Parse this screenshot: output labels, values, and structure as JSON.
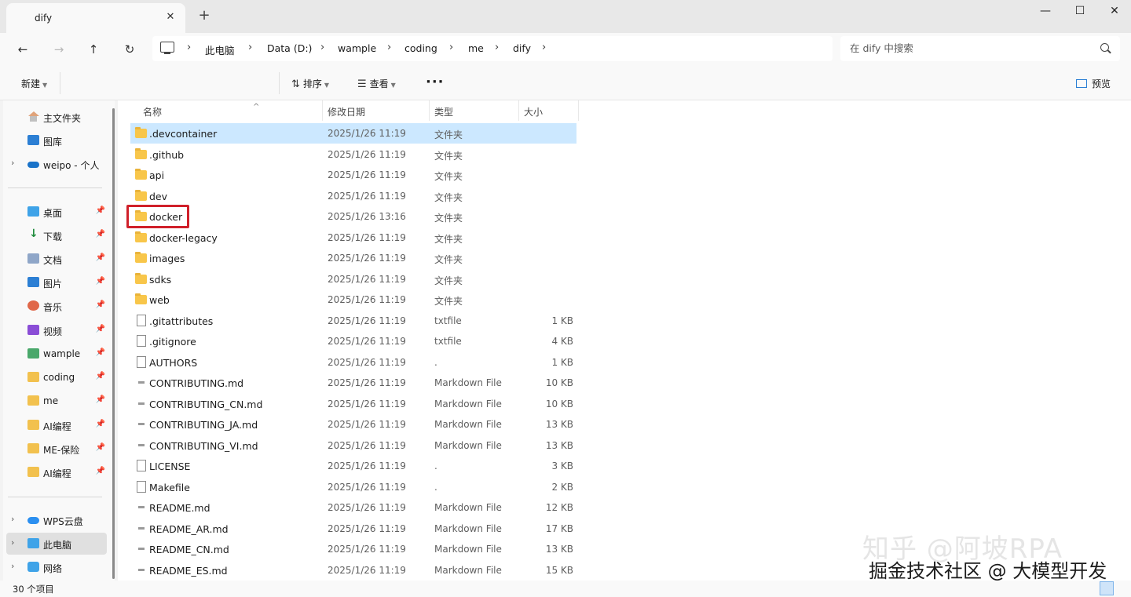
{
  "window": {
    "tab_title": "dify",
    "tab_close": "✕",
    "new_tab": "+",
    "minimize": "—",
    "maximize": "☐",
    "close": "✕"
  },
  "nav": {
    "back": "←",
    "forward": "→",
    "up": "↑",
    "refresh": "↻",
    "breadcrumbs": [
      "此电脑",
      "Data (D:)",
      "wample",
      "coding",
      "me",
      "dify"
    ],
    "chevron": "›",
    "search_placeholder": "在 dify 中搜索"
  },
  "toolbar": {
    "new_label": "新建",
    "sort_label": "排序",
    "view_label": "查看",
    "more_label": "···",
    "preview_label": "预览"
  },
  "sidebar": {
    "items": [
      {
        "label": "主文件夹",
        "icon": "home-icon"
      },
      {
        "label": "图库",
        "icon": "gallery-icon"
      },
      {
        "label": "weipo - 个人",
        "icon": "onedrive-icon"
      },
      {
        "label": "桌面",
        "icon": "desktop-icon"
      },
      {
        "label": "下载",
        "icon": "download-icon"
      },
      {
        "label": "文档",
        "icon": "documents-icon"
      },
      {
        "label": "图片",
        "icon": "pictures-icon"
      },
      {
        "label": "音乐",
        "icon": "music-icon"
      },
      {
        "label": "视频",
        "icon": "videos-icon"
      },
      {
        "label": "wample",
        "icon": "folder-icon"
      },
      {
        "label": "coding",
        "icon": "folder-icon"
      },
      {
        "label": "me",
        "icon": "folder-icon"
      },
      {
        "label": "AI编程",
        "icon": "folder-icon"
      },
      {
        "label": "ME-保险",
        "icon": "folder-icon"
      },
      {
        "label": "AI编程",
        "icon": "folder-icon"
      },
      {
        "label": "WPS云盘",
        "icon": "wps-cloud-icon"
      },
      {
        "label": "此电脑",
        "icon": "this-pc-icon"
      },
      {
        "label": "网络",
        "icon": "network-icon"
      }
    ],
    "pin": "📌",
    "expand": "›"
  },
  "columns": {
    "name": "名称",
    "date": "修改日期",
    "type": "类型",
    "size": "大小"
  },
  "files": [
    {
      "name": ".devcontainer",
      "date": "2025/1/26 11:19",
      "type": "文件夹",
      "size": "",
      "kind": "folder"
    },
    {
      "name": ".github",
      "date": "2025/1/26 11:19",
      "type": "文件夹",
      "size": "",
      "kind": "folder"
    },
    {
      "name": "api",
      "date": "2025/1/26 11:19",
      "type": "文件夹",
      "size": "",
      "kind": "folder"
    },
    {
      "name": "dev",
      "date": "2025/1/26 11:19",
      "type": "文件夹",
      "size": "",
      "kind": "folder"
    },
    {
      "name": "docker",
      "date": "2025/1/26 13:16",
      "type": "文件夹",
      "size": "",
      "kind": "folder"
    },
    {
      "name": "docker-legacy",
      "date": "2025/1/26 11:19",
      "type": "文件夹",
      "size": "",
      "kind": "folder"
    },
    {
      "name": "images",
      "date": "2025/1/26 11:19",
      "type": "文件夹",
      "size": "",
      "kind": "folder"
    },
    {
      "name": "sdks",
      "date": "2025/1/26 11:19",
      "type": "文件夹",
      "size": "",
      "kind": "folder"
    },
    {
      "name": "web",
      "date": "2025/1/26 11:19",
      "type": "文件夹",
      "size": "",
      "kind": "folder"
    },
    {
      "name": ".gitattributes",
      "date": "2025/1/26 11:19",
      "type": "txtfile",
      "size": "1 KB",
      "kind": "file"
    },
    {
      "name": ".gitignore",
      "date": "2025/1/26 11:19",
      "type": "txtfile",
      "size": "4 KB",
      "kind": "file"
    },
    {
      "name": "AUTHORS",
      "date": "2025/1/26 11:19",
      "type": ".",
      "size": "1 KB",
      "kind": "file"
    },
    {
      "name": "CONTRIBUTING.md",
      "date": "2025/1/26 11:19",
      "type": "Markdown File",
      "size": "10 KB",
      "kind": "md"
    },
    {
      "name": "CONTRIBUTING_CN.md",
      "date": "2025/1/26 11:19",
      "type": "Markdown File",
      "size": "10 KB",
      "kind": "md"
    },
    {
      "name": "CONTRIBUTING_JA.md",
      "date": "2025/1/26 11:19",
      "type": "Markdown File",
      "size": "13 KB",
      "kind": "md"
    },
    {
      "name": "CONTRIBUTING_VI.md",
      "date": "2025/1/26 11:19",
      "type": "Markdown File",
      "size": "13 KB",
      "kind": "md"
    },
    {
      "name": "LICENSE",
      "date": "2025/1/26 11:19",
      "type": ".",
      "size": "3 KB",
      "kind": "file"
    },
    {
      "name": "Makefile",
      "date": "2025/1/26 11:19",
      "type": ".",
      "size": "2 KB",
      "kind": "file"
    },
    {
      "name": "README.md",
      "date": "2025/1/26 11:19",
      "type": "Markdown File",
      "size": "12 KB",
      "kind": "md"
    },
    {
      "name": "README_AR.md",
      "date": "2025/1/26 11:19",
      "type": "Markdown File",
      "size": "17 KB",
      "kind": "md"
    },
    {
      "name": "README_CN.md",
      "date": "2025/1/26 11:19",
      "type": "Markdown File",
      "size": "13 KB",
      "kind": "md"
    },
    {
      "name": "README_ES.md",
      "date": "2025/1/26 11:19",
      "type": "Markdown File",
      "size": "15 KB",
      "kind": "md"
    }
  ],
  "status": {
    "count": "30 个项目"
  },
  "watermark": {
    "line1": "知乎 @阿坡RPA",
    "line2": "掘金技术社区 @ 大模型开发"
  },
  "colors": {
    "highlight_box": "#d0202a",
    "selected_row": "#cce8ff",
    "folder": "#f8c64a"
  }
}
